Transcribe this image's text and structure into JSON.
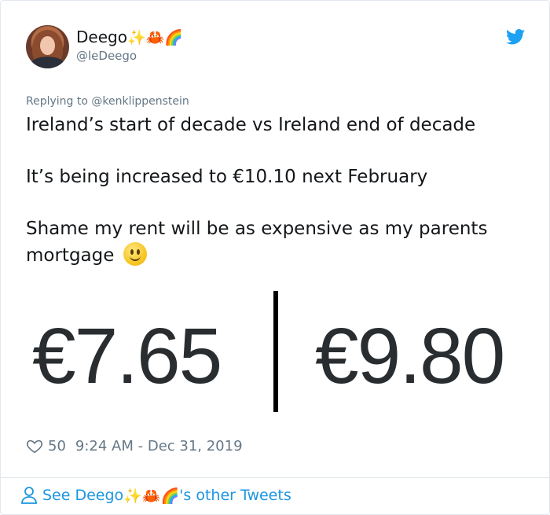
{
  "author": {
    "display_name": "Deego",
    "emojis": "✨🦀🌈",
    "handle": "@leDeego"
  },
  "reply": {
    "prefix": "Replying to ",
    "user": "@kenklippenstein"
  },
  "tweet": {
    "line1": "Ireland’s start of decade vs Ireland end of decade",
    "line2": "It’s being increased to €10.10 next February",
    "line3": "Shame my rent will be as expensive as my parents mortgage"
  },
  "media": {
    "left_price": "€7.65",
    "right_price": "€9.80"
  },
  "meta": {
    "likes": "50",
    "timestamp": "9:24 AM - Dec 31, 2019"
  },
  "footer": {
    "prefix": "See Deego",
    "emojis": "✨🦀🌈",
    "suffix": "'s other Tweets"
  },
  "colors": {
    "link": "#1b95e0",
    "muted": "#657786",
    "twitter_blue": "#1da1f2"
  },
  "icons": [
    "twitter-bird-icon",
    "heart-icon",
    "person-icon",
    "smiley-emoji"
  ]
}
